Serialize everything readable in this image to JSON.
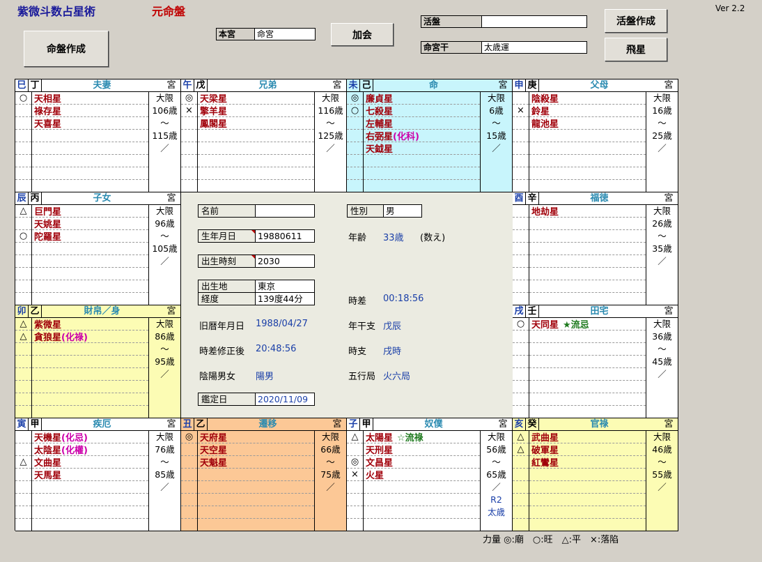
{
  "app": {
    "title": "紫微斗数占星術",
    "subtitle": "元命盤",
    "version": "Ver 2.2"
  },
  "buttons": {
    "create": "命盤作成",
    "kakai": "加会",
    "katsuban": "活盤作成",
    "hisei": "飛星"
  },
  "fields": {
    "honkyu": {
      "label": "本宮",
      "value": "命宮"
    },
    "katsuban": {
      "label": "活盤",
      "value": ""
    },
    "meikyukan": {
      "label": "命宮干",
      "value": "太歳運"
    }
  },
  "palaces": {
    "si": {
      "branch": "巳",
      "stem": "丁",
      "name": "夫妻",
      "gu": "宮",
      "marks": [
        "○",
        "",
        ""
      ],
      "stars": [
        {
          "t": "天相星"
        },
        {
          "t": "祿存星"
        },
        {
          "t": "天喜星"
        }
      ],
      "age": [
        "大限",
        "106歳",
        "～",
        "115歳",
        "／"
      ]
    },
    "wu": {
      "branch": "午",
      "stem": "戊",
      "name": "兄弟",
      "gu": "宮",
      "marks": [
        "◎",
        "×",
        ""
      ],
      "stars": [
        {
          "t": "天梁星"
        },
        {
          "t": "擎羊星"
        },
        {
          "t": "鳳閣星"
        }
      ],
      "age": [
        "大限",
        "116歳",
        "～",
        "125歳",
        "／"
      ]
    },
    "wei": {
      "branch": "未",
      "stem": "己",
      "name": "命",
      "gu": "宮",
      "marks": [
        "◎",
        "○",
        "",
        "",
        ""
      ],
      "stars": [
        {
          "t": "廉貞星"
        },
        {
          "t": "七殺星"
        },
        {
          "t": "左輔星"
        },
        {
          "t": "右弼星",
          "m": "(化科)"
        },
        {
          "t": "天鉞星"
        }
      ],
      "age": [
        "大限",
        "6歳",
        "～",
        "15歳",
        "／"
      ]
    },
    "shen": {
      "branch": "申",
      "stem": "庚",
      "name": "父母",
      "gu": "宮",
      "marks": [
        "",
        "×",
        ""
      ],
      "stars": [
        {
          "t": "陰殺星"
        },
        {
          "t": "鈴星"
        },
        {
          "t": "龍池星"
        }
      ],
      "age": [
        "大限",
        "16歳",
        "～",
        "25歳",
        "／"
      ]
    },
    "chen": {
      "branch": "辰",
      "stem": "丙",
      "name": "子女",
      "gu": "宮",
      "marks": [
        "△",
        "",
        "○"
      ],
      "stars": [
        {
          "t": "巨門星"
        },
        {
          "t": "天姚星"
        },
        {
          "t": "陀羅星"
        }
      ],
      "age": [
        "大限",
        "96歳",
        "～",
        "105歳",
        "／"
      ]
    },
    "you": {
      "branch": "酉",
      "stem": "辛",
      "name": "福徳",
      "gu": "宮",
      "marks": [
        ""
      ],
      "stars": [
        {
          "t": "地劫星"
        }
      ],
      "age": [
        "大限",
        "26歳",
        "～",
        "35歳",
        "／"
      ]
    },
    "mao": {
      "branch": "卯",
      "stem": "乙",
      "name": "財帛／身",
      "gu": "宮",
      "marks": [
        "△",
        "△"
      ],
      "stars": [
        {
          "t": "紫微星"
        },
        {
          "t": "貪狼星",
          "m": "(化祿)"
        }
      ],
      "age": [
        "大限",
        "86歳",
        "～",
        "95歳",
        "／"
      ]
    },
    "xu": {
      "branch": "戌",
      "stem": "壬",
      "name": "田宅",
      "gu": "宮",
      "marks": [
        "○"
      ],
      "stars": [
        {
          "t": "天同星",
          "g": "★流忌"
        }
      ],
      "age": [
        "大限",
        "36歳",
        "～",
        "45歳",
        "／"
      ]
    },
    "yin": {
      "branch": "寅",
      "stem": "甲",
      "name": "疾厄",
      "gu": "宮",
      "marks": [
        "",
        "",
        "△",
        ""
      ],
      "stars": [
        {
          "t": "天機星",
          "m": "(化忌)"
        },
        {
          "t": "太陰星",
          "m": "(化權)"
        },
        {
          "t": "文曲星"
        },
        {
          "t": "天馬星"
        }
      ],
      "age": [
        "大限",
        "76歳",
        "～",
        "85歳",
        "／"
      ]
    },
    "chou": {
      "branch": "丑",
      "stem": "乙",
      "name": "遷移",
      "gu": "宮",
      "marks": [
        "◎",
        "",
        ""
      ],
      "stars": [
        {
          "t": "天府星"
        },
        {
          "t": "天空星"
        },
        {
          "t": "天魁星"
        }
      ],
      "age": [
        "大限",
        "66歳",
        "～",
        "75歳",
        "／"
      ]
    },
    "zi": {
      "branch": "子",
      "stem": "甲",
      "name": "奴僕",
      "gu": "宮",
      "marks": [
        "△",
        "",
        "◎",
        "×"
      ],
      "stars": [
        {
          "t": "太陽星",
          "g": "☆流祿"
        },
        {
          "t": "天刑星"
        },
        {
          "t": "文昌星"
        },
        {
          "t": "火星"
        }
      ],
      "age": [
        "大限",
        "56歳",
        "～",
        "65歳",
        "／",
        "R2",
        "太歳"
      ]
    },
    "hai": {
      "branch": "亥",
      "stem": "癸",
      "name": "官祿",
      "gu": "宮",
      "marks": [
        "△",
        "△",
        ""
      ],
      "stars": [
        {
          "t": "武曲星"
        },
        {
          "t": "破軍星"
        },
        {
          "t": "紅鸞星"
        }
      ],
      "age": [
        "大限",
        "46歳",
        "～",
        "55歳",
        "／"
      ]
    }
  },
  "info": {
    "name": {
      "label": "名前",
      "value": ""
    },
    "sex": {
      "label": "性別",
      "value": "男"
    },
    "birthdate": {
      "label": "生年月日",
      "value": "19880611"
    },
    "age": {
      "label": "年齢",
      "value": "33歳",
      "note": "(数え)"
    },
    "birthtime": {
      "label": "出生時刻",
      "value": "2030"
    },
    "birthplace": {
      "label": "出生地",
      "value": "東京"
    },
    "longitude": {
      "label": "経度",
      "value": "139度44分"
    },
    "timediff": {
      "label": "時差",
      "value": "00:18:56"
    },
    "lunar": {
      "label": "旧暦年月日",
      "value": "1988/04/27"
    },
    "nenkanshi": {
      "label": "年干支",
      "value": "戊辰"
    },
    "corrected": {
      "label": "時差修正後",
      "value": "20:48:56"
    },
    "jishi": {
      "label": "時支",
      "value": "戌時"
    },
    "inyo": {
      "label": "陰陽男女",
      "value": "陽男"
    },
    "gogyo": {
      "label": "五行局",
      "value": "火六局"
    },
    "kantei": {
      "label": "鑑定日",
      "value": "2020/11/09"
    }
  },
  "legend": "力量 ◎:廟　○:旺　△:平　×:落陷",
  "colors": {
    "ming": "#c8f5fc",
    "caibo": "#fcfcb4",
    "qianyi": "#fcc896",
    "guanlu": "#fcfcb4",
    "center": "#ebebe1"
  }
}
